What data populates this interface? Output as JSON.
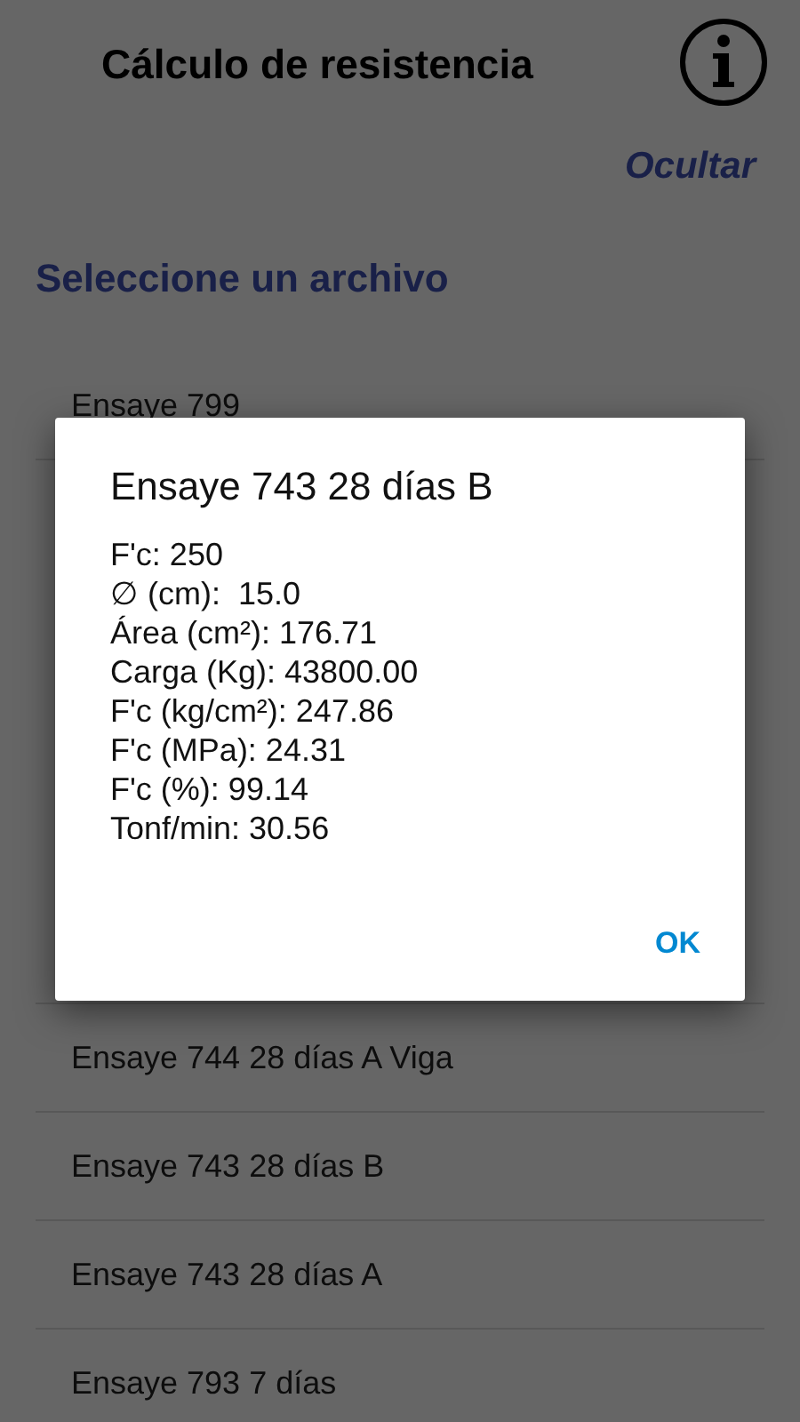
{
  "header": {
    "title": "Cálculo de resistencia"
  },
  "hide_link": "Ocultar",
  "section_title": "Seleccione un archivo",
  "files_top": [
    {
      "label": "Ensaye 799"
    }
  ],
  "files_bottom": [
    {
      "label": "Ensaye 744 28 días A Viga"
    },
    {
      "label": "Ensaye 743 28 días B"
    },
    {
      "label": "Ensaye 743 28 días A"
    },
    {
      "label": "Ensaye 793 7 días"
    }
  ],
  "dialog": {
    "title": "Ensaye 743 28 días B",
    "lines": [
      "F'c: 250",
      "∅ (cm):  15.0",
      "Área (cm²): 176.71",
      "Carga (Kg): 43800.00",
      "F'c (kg/cm²): 247.86",
      "F'c (MPa): 24.31",
      "F'c (%): 99.14",
      "Tonf/min: 30.56"
    ],
    "button": "OK"
  }
}
